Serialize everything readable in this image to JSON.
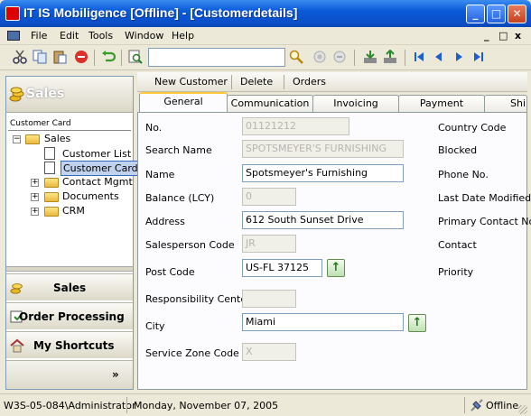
{
  "window": {
    "title": "IT IS Mobiligence [Offline] - [Customerdetails]"
  },
  "menu": {
    "items": [
      "File",
      "Edit",
      "Tools",
      "Window",
      "Help"
    ]
  },
  "mdi_controls": [
    "_",
    "□",
    "x"
  ],
  "toolbar": {
    "find_value": ""
  },
  "sidebar": {
    "header": "Sales",
    "card_label": "Customer Card",
    "tree": {
      "root": "Sales",
      "children": [
        "Customer List",
        "Customer Card"
      ],
      "siblings": [
        "Contact Mgmt",
        "Documents",
        "CRM"
      ]
    },
    "nav": [
      "Sales",
      "Order Processing",
      "My Shortcuts"
    ],
    "more_label": "»"
  },
  "actions": [
    "New Customer",
    "Delete",
    "Orders"
  ],
  "tabs": [
    "General",
    "Communication",
    "Invoicing",
    "Payment",
    "Shi"
  ],
  "form": {
    "left": {
      "no": {
        "label": "No.",
        "value": "01121212"
      },
      "search_name": {
        "label": "Search Name",
        "value": "SPOTSMEYER'S FURNISHING"
      },
      "name": {
        "label": "Name",
        "value": "Spotsmeyer's Furnishing"
      },
      "balance": {
        "label": "Balance (LCY)",
        "value": "0"
      },
      "address": {
        "label": "Address",
        "value": "612 South Sunset Drive"
      },
      "salesperson": {
        "label": "Salesperson Code",
        "value": "JR"
      },
      "post_code": {
        "label": "Post Code",
        "value": "US-FL 37125"
      },
      "responsibility": {
        "label": "Responsibility Center",
        "value": ""
      },
      "city": {
        "label": "City",
        "value": "Miami"
      },
      "service_zone": {
        "label": "Service Zone Code",
        "value": "X"
      }
    },
    "right_labels": [
      "Country Code",
      "Blocked",
      "Phone No.",
      "Last Date Modified",
      "Primary Contact No.",
      "Contact",
      "Priority"
    ]
  },
  "status": {
    "user": "W3S-05-084\\Administrator",
    "date": "Monday, November 07, 2005",
    "mode": "Offline"
  },
  "colors": {
    "titlebar": "#0a5ad8",
    "tab_highlight": "#ffc83c",
    "readonly_text": "#b7b6ae"
  }
}
